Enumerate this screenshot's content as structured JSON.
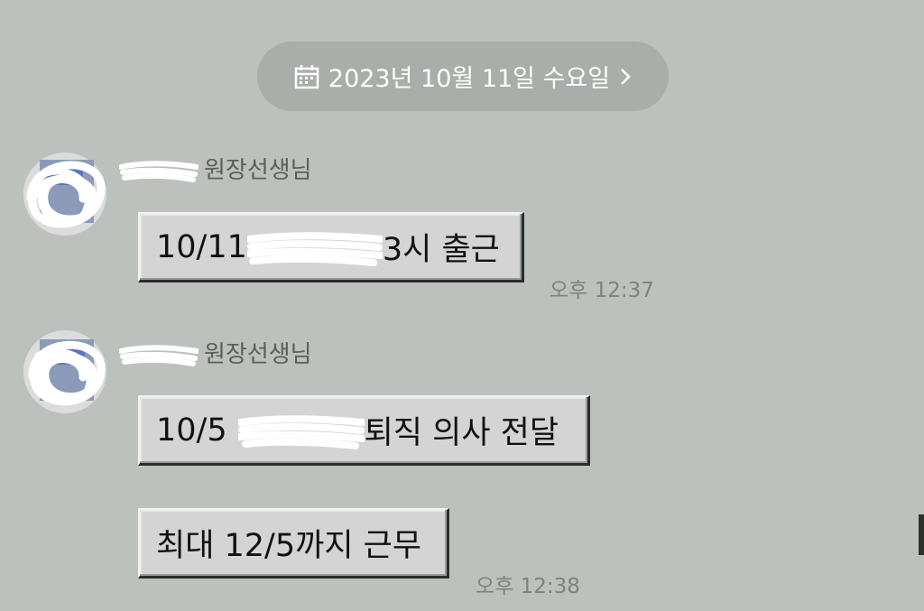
{
  "date_header": {
    "label": "2023년 10월 11일 수요일",
    "icon": "calendar-icon",
    "chevron": "chevron-right-icon"
  },
  "messages": [
    {
      "sender": "원장선생님",
      "bubbles": [
        {
          "prefix": "10/11",
          "suffix": "3시 출근"
        }
      ],
      "time": "오후 12:37"
    },
    {
      "sender": "원장선생님",
      "bubbles": [
        {
          "prefix": "10/5",
          "suffix": "퇴직 의사 전달"
        },
        {
          "text": "최대 12/5까지 근무"
        }
      ],
      "time": "오후 12:38"
    }
  ],
  "colors": {
    "background": "#bcc1bd",
    "pill": "#a9aeaa",
    "bubble": "#d4d4d4",
    "time_text": "#7e827f"
  }
}
